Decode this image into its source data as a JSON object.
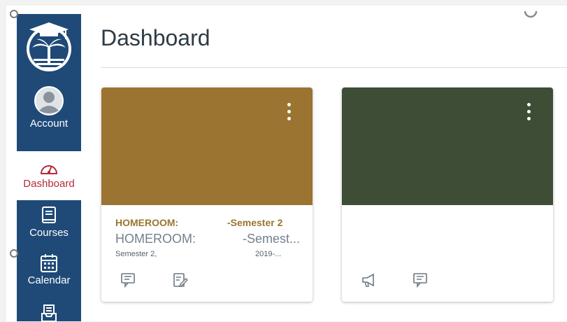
{
  "header": {
    "title": "Dashboard"
  },
  "nav": {
    "items": [
      {
        "label": "Account",
        "icon": "avatar-icon"
      },
      {
        "label": "Dashboard",
        "icon": "dashboard-gauge-icon",
        "active": true
      },
      {
        "label": "Courses",
        "icon": "book-icon"
      },
      {
        "label": "Calendar",
        "icon": "calendar-icon"
      },
      {
        "label": "",
        "icon": "inbox-icon"
      }
    ]
  },
  "cards": [
    {
      "color": "#9a7430",
      "title_left": "HOMEROOM:",
      "title_right": "-Semester 2",
      "subtitle_left": "HOMEROOM:",
      "subtitle_right": "-Semest...",
      "term_left": "Semester 2,",
      "term_right": "2019-...",
      "actions": [
        "discussions-icon",
        "assignments-icon"
      ]
    },
    {
      "color": "#3d4d36",
      "title_left": "",
      "title_right": "",
      "subtitle_left": "",
      "subtitle_right": "",
      "term_left": "",
      "term_right": "",
      "actions": [
        "announcements-icon",
        "discussions-icon"
      ]
    }
  ],
  "colors": {
    "nav_bg": "#1f4a78",
    "active_label": "#b52a3a",
    "card_title": "#9a7530"
  }
}
